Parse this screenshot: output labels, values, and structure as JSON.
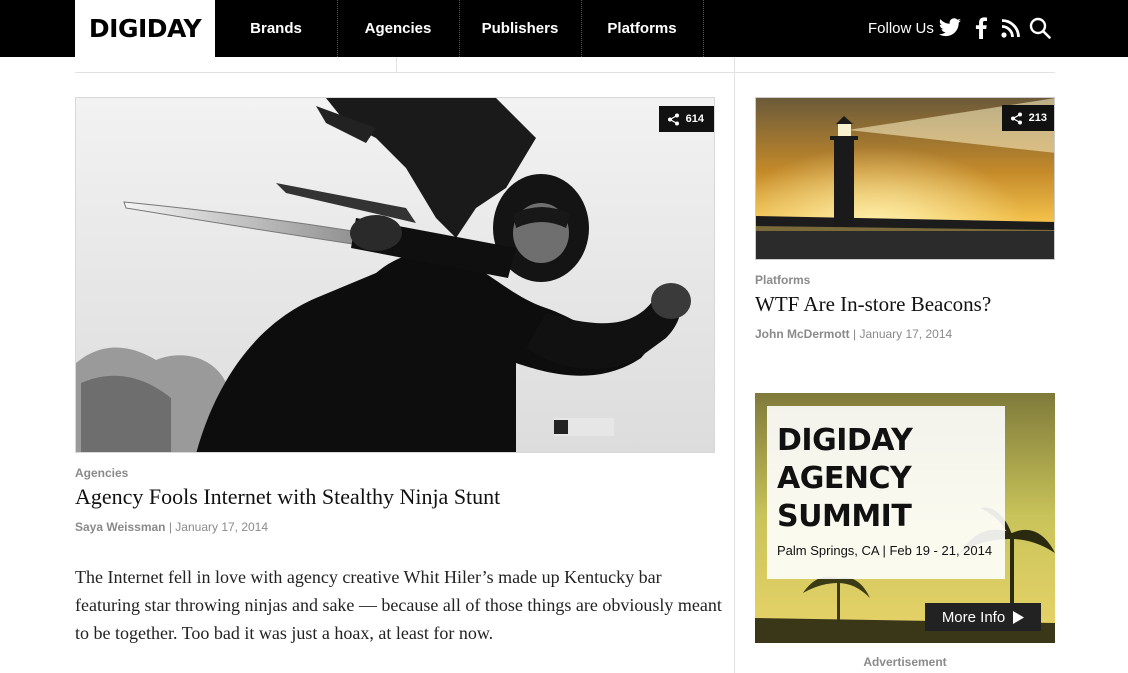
{
  "nav": {
    "logo": "DIGIDAY",
    "items": [
      {
        "label": "Brands"
      },
      {
        "label": "Agencies"
      },
      {
        "label": "Publishers"
      },
      {
        "label": "Platforms"
      }
    ],
    "follow_label": "Follow Us",
    "icons": [
      "twitter-icon",
      "facebook-icon",
      "rss-icon",
      "search-icon"
    ]
  },
  "main_story": {
    "share_count": "614",
    "category": "Agencies",
    "headline": "Agency Fools Internet with Stealthy Ninja Stunt",
    "author": "Saya Weissman",
    "date": "| January 17, 2014",
    "excerpt": "The Internet fell in love with agency creative Whit Hiler’s made up Kentucky bar featuring star throwing ninjas and sake — because all of those things are obviously meant to be together. Too bad it was just a hoax, at least for now."
  },
  "side_story": {
    "share_count": "213",
    "category": "Platforms",
    "headline": "WTF Are In-store Beacons?",
    "author": "John McDermott",
    "date": "| January 17, 2014"
  },
  "ad": {
    "title_line1": "DIGIDAY",
    "title_line2": "AGENCY",
    "title_line3": "SUMMIT",
    "subtitle": "Palm Springs, CA | Feb 19 - 21, 2014",
    "button": "More Info",
    "label": "Advertisement"
  },
  "colors": {
    "nav_bg": "#000000",
    "meta_gray": "#8a8a8a",
    "sunset_gold": "#e8a92c"
  }
}
